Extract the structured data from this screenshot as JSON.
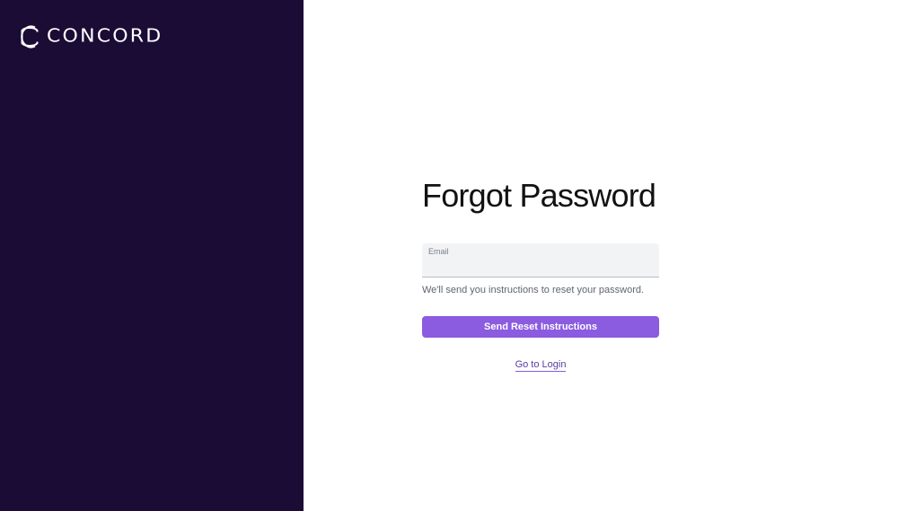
{
  "brand": {
    "name": "CONCORD",
    "logo_icon": "concord-logo-icon"
  },
  "colors": {
    "sidebar_bg": "#1b0c36",
    "accent": "#8b5be0",
    "input_bg": "#f2f3f5"
  },
  "form": {
    "title": "Forgot Password",
    "email_label": "Email",
    "email_value": "",
    "helper_text": "We'll send you instructions to reset your password.",
    "submit_label": "Send Reset Instructions",
    "login_link_label": "Go to Login"
  }
}
